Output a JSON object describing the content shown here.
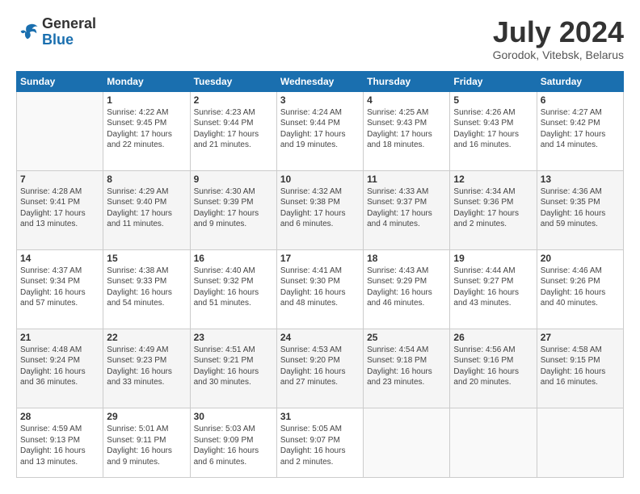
{
  "header": {
    "logo_line1": "General",
    "logo_line2": "Blue",
    "month": "July 2024",
    "location": "Gorodok, Vitebsk, Belarus"
  },
  "weekdays": [
    "Sunday",
    "Monday",
    "Tuesday",
    "Wednesday",
    "Thursday",
    "Friday",
    "Saturday"
  ],
  "weeks": [
    [
      {
        "day": "",
        "info": ""
      },
      {
        "day": "1",
        "info": "Sunrise: 4:22 AM\nSunset: 9:45 PM\nDaylight: 17 hours\nand 22 minutes."
      },
      {
        "day": "2",
        "info": "Sunrise: 4:23 AM\nSunset: 9:44 PM\nDaylight: 17 hours\nand 21 minutes."
      },
      {
        "day": "3",
        "info": "Sunrise: 4:24 AM\nSunset: 9:44 PM\nDaylight: 17 hours\nand 19 minutes."
      },
      {
        "day": "4",
        "info": "Sunrise: 4:25 AM\nSunset: 9:43 PM\nDaylight: 17 hours\nand 18 minutes."
      },
      {
        "day": "5",
        "info": "Sunrise: 4:26 AM\nSunset: 9:43 PM\nDaylight: 17 hours\nand 16 minutes."
      },
      {
        "day": "6",
        "info": "Sunrise: 4:27 AM\nSunset: 9:42 PM\nDaylight: 17 hours\nand 14 minutes."
      }
    ],
    [
      {
        "day": "7",
        "info": "Sunrise: 4:28 AM\nSunset: 9:41 PM\nDaylight: 17 hours\nand 13 minutes."
      },
      {
        "day": "8",
        "info": "Sunrise: 4:29 AM\nSunset: 9:40 PM\nDaylight: 17 hours\nand 11 minutes."
      },
      {
        "day": "9",
        "info": "Sunrise: 4:30 AM\nSunset: 9:39 PM\nDaylight: 17 hours\nand 9 minutes."
      },
      {
        "day": "10",
        "info": "Sunrise: 4:32 AM\nSunset: 9:38 PM\nDaylight: 17 hours\nand 6 minutes."
      },
      {
        "day": "11",
        "info": "Sunrise: 4:33 AM\nSunset: 9:37 PM\nDaylight: 17 hours\nand 4 minutes."
      },
      {
        "day": "12",
        "info": "Sunrise: 4:34 AM\nSunset: 9:36 PM\nDaylight: 17 hours\nand 2 minutes."
      },
      {
        "day": "13",
        "info": "Sunrise: 4:36 AM\nSunset: 9:35 PM\nDaylight: 16 hours\nand 59 minutes."
      }
    ],
    [
      {
        "day": "14",
        "info": "Sunrise: 4:37 AM\nSunset: 9:34 PM\nDaylight: 16 hours\nand 57 minutes."
      },
      {
        "day": "15",
        "info": "Sunrise: 4:38 AM\nSunset: 9:33 PM\nDaylight: 16 hours\nand 54 minutes."
      },
      {
        "day": "16",
        "info": "Sunrise: 4:40 AM\nSunset: 9:32 PM\nDaylight: 16 hours\nand 51 minutes."
      },
      {
        "day": "17",
        "info": "Sunrise: 4:41 AM\nSunset: 9:30 PM\nDaylight: 16 hours\nand 48 minutes."
      },
      {
        "day": "18",
        "info": "Sunrise: 4:43 AM\nSunset: 9:29 PM\nDaylight: 16 hours\nand 46 minutes."
      },
      {
        "day": "19",
        "info": "Sunrise: 4:44 AM\nSunset: 9:27 PM\nDaylight: 16 hours\nand 43 minutes."
      },
      {
        "day": "20",
        "info": "Sunrise: 4:46 AM\nSunset: 9:26 PM\nDaylight: 16 hours\nand 40 minutes."
      }
    ],
    [
      {
        "day": "21",
        "info": "Sunrise: 4:48 AM\nSunset: 9:24 PM\nDaylight: 16 hours\nand 36 minutes."
      },
      {
        "day": "22",
        "info": "Sunrise: 4:49 AM\nSunset: 9:23 PM\nDaylight: 16 hours\nand 33 minutes."
      },
      {
        "day": "23",
        "info": "Sunrise: 4:51 AM\nSunset: 9:21 PM\nDaylight: 16 hours\nand 30 minutes."
      },
      {
        "day": "24",
        "info": "Sunrise: 4:53 AM\nSunset: 9:20 PM\nDaylight: 16 hours\nand 27 minutes."
      },
      {
        "day": "25",
        "info": "Sunrise: 4:54 AM\nSunset: 9:18 PM\nDaylight: 16 hours\nand 23 minutes."
      },
      {
        "day": "26",
        "info": "Sunrise: 4:56 AM\nSunset: 9:16 PM\nDaylight: 16 hours\nand 20 minutes."
      },
      {
        "day": "27",
        "info": "Sunrise: 4:58 AM\nSunset: 9:15 PM\nDaylight: 16 hours\nand 16 minutes."
      }
    ],
    [
      {
        "day": "28",
        "info": "Sunrise: 4:59 AM\nSunset: 9:13 PM\nDaylight: 16 hours\nand 13 minutes."
      },
      {
        "day": "29",
        "info": "Sunrise: 5:01 AM\nSunset: 9:11 PM\nDaylight: 16 hours\nand 9 minutes."
      },
      {
        "day": "30",
        "info": "Sunrise: 5:03 AM\nSunset: 9:09 PM\nDaylight: 16 hours\nand 6 minutes."
      },
      {
        "day": "31",
        "info": "Sunrise: 5:05 AM\nSunset: 9:07 PM\nDaylight: 16 hours\nand 2 minutes."
      },
      {
        "day": "",
        "info": ""
      },
      {
        "day": "",
        "info": ""
      },
      {
        "day": "",
        "info": ""
      }
    ]
  ]
}
